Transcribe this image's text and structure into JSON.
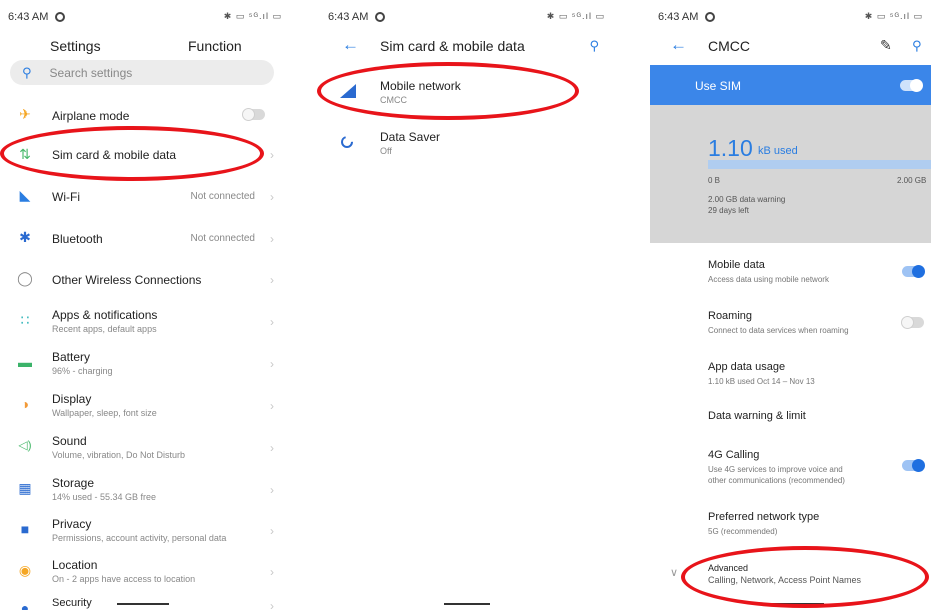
{
  "status": {
    "time": "6:43 AM",
    "icons": "✱ ▭ ⁵ᴳ.ıl ▭"
  },
  "panel1": {
    "title": "Settings",
    "tab": "Function",
    "search_placeholder": "Search settings",
    "items": [
      {
        "icon": "airplane-icon",
        "title": "Airplane mode",
        "subtitle": "",
        "value": ""
      },
      {
        "icon": "sim-data-icon",
        "title": "Sim card & mobile data",
        "subtitle": "",
        "value": ""
      },
      {
        "icon": "wifi-icon",
        "title": "Wi-Fi",
        "subtitle": "",
        "value": "Not connected"
      },
      {
        "icon": "bluetooth-icon",
        "title": "Bluetooth",
        "subtitle": "",
        "value": "Not connected"
      },
      {
        "icon": "wireless-icon",
        "title": "Other Wireless Connections",
        "subtitle": "",
        "value": ""
      },
      {
        "icon": "apps-icon",
        "title": "Apps & notifications",
        "subtitle": "Recent apps, default apps",
        "value": ""
      },
      {
        "icon": "battery-icon",
        "title": "Battery",
        "subtitle": "96% - charging",
        "value": ""
      },
      {
        "icon": "display-icon",
        "title": "Display",
        "subtitle": "Wallpaper, sleep, font size",
        "value": ""
      },
      {
        "icon": "sound-icon",
        "title": "Sound",
        "subtitle": "Volume, vibration, Do Not Disturb",
        "value": ""
      },
      {
        "icon": "storage-icon",
        "title": "Storage",
        "subtitle": "14% used - 55.34 GB free",
        "value": ""
      },
      {
        "icon": "privacy-icon",
        "title": "Privacy",
        "subtitle": "Permissions, account activity, personal data",
        "value": ""
      },
      {
        "icon": "location-icon",
        "title": "Location",
        "subtitle": "On - 2 apps have access to location",
        "value": ""
      },
      {
        "icon": "security-icon",
        "title": "Security",
        "subtitle": "",
        "value": ""
      }
    ]
  },
  "panel2": {
    "title": "Sim card & mobile data",
    "items": [
      {
        "title": "Mobile network",
        "subtitle": "CMCC"
      },
      {
        "title": "Data Saver",
        "subtitle": "Off"
      }
    ]
  },
  "panel3": {
    "title": "CMCC",
    "use_sim": "Use SIM",
    "usage_value": "1.10",
    "usage_unit": "kB used",
    "range_min": "0 B",
    "range_max": "2.00 GB",
    "warning": "2.00 GB data warning",
    "days_left": "29 days left",
    "items": [
      {
        "title": "Mobile data",
        "subtitle": "Access data using mobile network",
        "subtitle2": ""
      },
      {
        "title": "Roaming",
        "subtitle": "Connect to data services when roaming",
        "subtitle2": ""
      },
      {
        "title": "App data usage",
        "subtitle": "1.10 kB used Oct 14 – Nov 13",
        "subtitle2": ""
      },
      {
        "title": "Data warning & limit",
        "subtitle": "",
        "subtitle2": ""
      },
      {
        "title": "4G Calling",
        "subtitle": "Use 4G services to improve voice and",
        "subtitle2": "other communications (recommended)"
      },
      {
        "title": "Preferred network type",
        "subtitle": "5G (recommended)",
        "subtitle2": ""
      },
      {
        "title": "Advanced",
        "subtitle": "Calling, Network, Access Point Names",
        "subtitle2": ""
      }
    ]
  },
  "colors": {
    "accent": "#2a7de1",
    "sim_bar": "#3b86e9",
    "usage_bg": "#d6d6d6",
    "annotation": "#e8141a"
  }
}
